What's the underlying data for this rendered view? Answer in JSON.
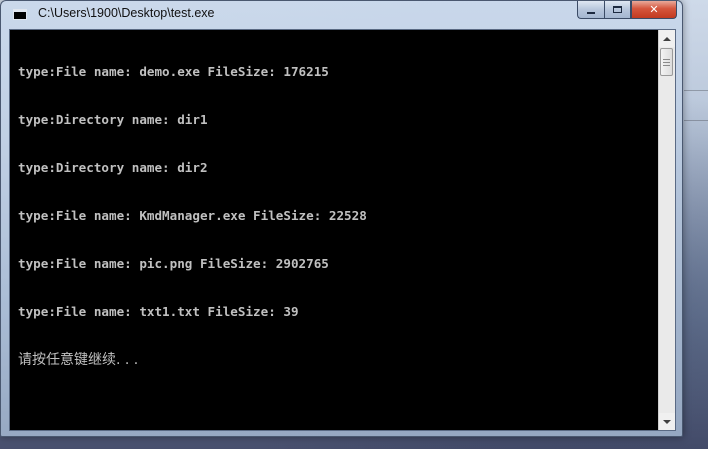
{
  "window": {
    "title": "C:\\Users\\1900\\Desktop\\test.exe",
    "icon": "console-app-icon"
  },
  "controls": {
    "minimize": "minimize",
    "maximize": "maximize",
    "close": "✕"
  },
  "console": {
    "lines": [
      "type:File name: demo.exe FileSize: 176215",
      "type:Directory name: dir1",
      "type:Directory name: dir2",
      "type:File name: KmdManager.exe FileSize: 22528",
      "type:File name: pic.png FileSize: 2902765",
      "type:File name: txt1.txt FileSize: 39"
    ],
    "prompt": "请按任意键继续. . ."
  },
  "colors": {
    "console_bg": "#000000",
    "console_text": "#c0c0c0",
    "close_button": "#c23a20"
  }
}
